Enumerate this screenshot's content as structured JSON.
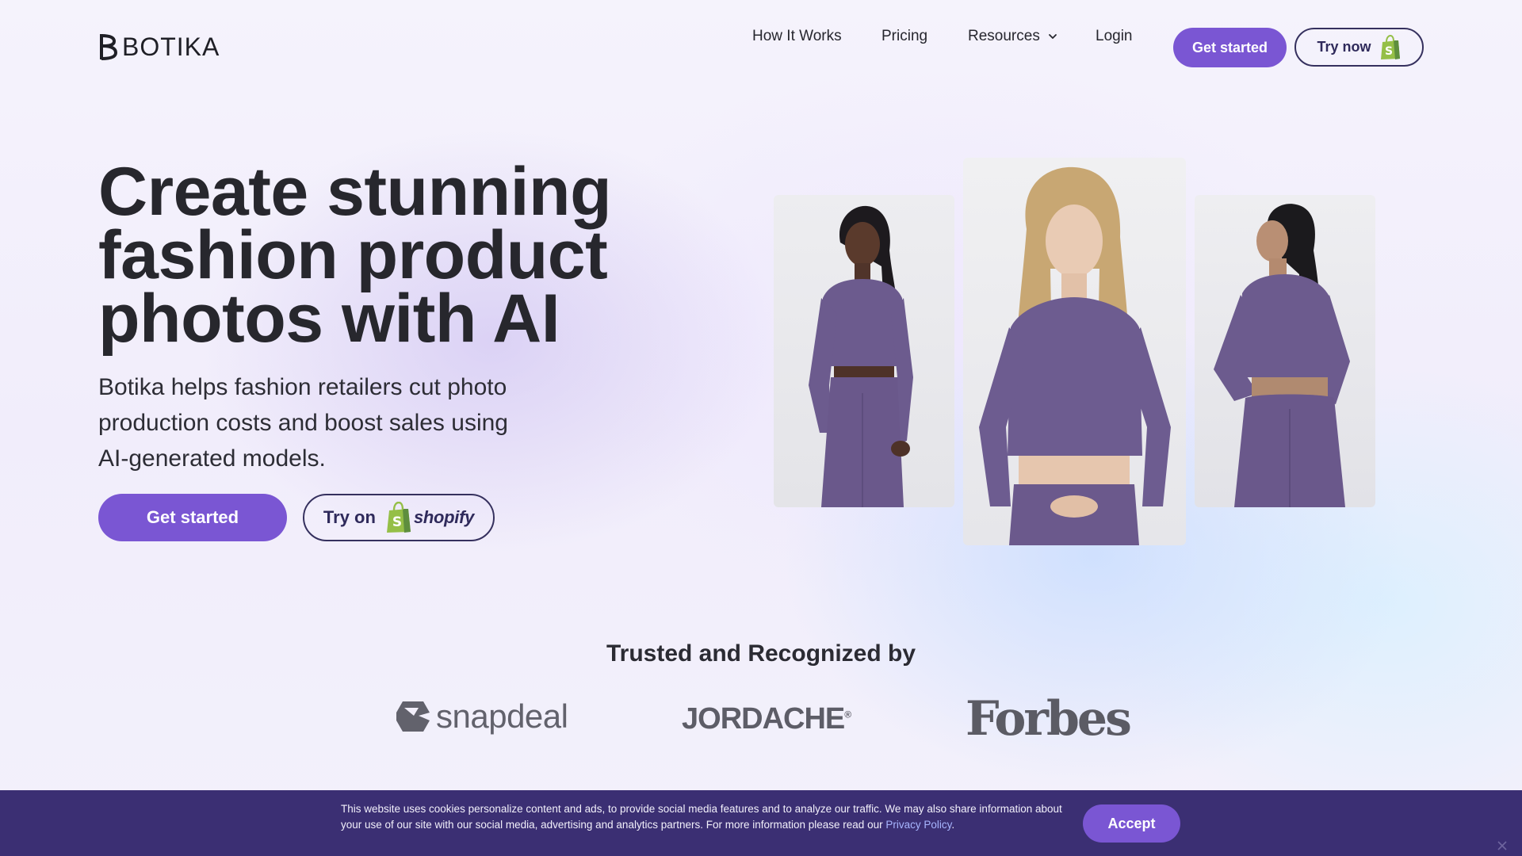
{
  "header": {
    "logo_text": "BOTIKA",
    "nav": {
      "how_it_works": "How It Works",
      "pricing": "Pricing",
      "resources": "Resources",
      "login": "Login"
    },
    "get_started": "Get started",
    "try_now": "Try now"
  },
  "hero": {
    "title_line1": "Create stunning",
    "title_line2": "fashion product",
    "title_line3": "photos with AI",
    "subtitle": "Botika helps fashion retailers cut photo production costs and boost sales using AI-generated models.",
    "get_started": "Get started",
    "try_on": "Try on",
    "shopify": "shopify"
  },
  "trusted": {
    "title": "Trusted and Recognized by",
    "brands": [
      "snapdeal",
      "JORDACHE",
      "Forbes"
    ]
  },
  "cookie": {
    "text": "This website uses cookies personalize content and ads, to provide social media features and to analyze our traffic. We may also share information about your use of our site with our social media, advertising and analytics partners. For more information please read our ",
    "link": "Privacy Policy",
    "period": ".",
    "accept": "Accept"
  },
  "colors": {
    "accent": "#7a56d3",
    "dark_outline": "#35305e",
    "cookie_bg": "#3b2f73",
    "shopify_green": "#95bf47"
  },
  "icons": [
    "botika-logo-icon",
    "chevron-down-icon",
    "shopify-bag-icon",
    "snapdeal-logo-icon",
    "close-icon"
  ]
}
